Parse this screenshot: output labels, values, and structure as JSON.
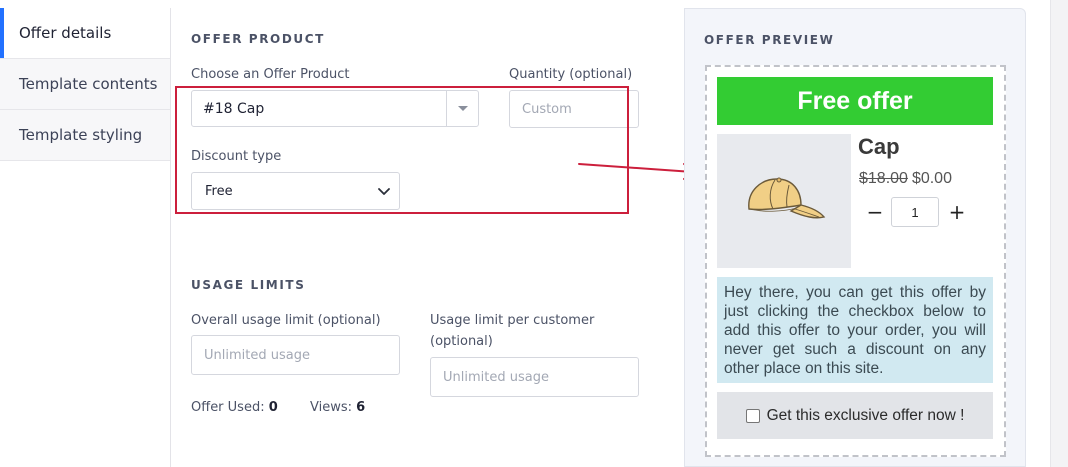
{
  "tabs": [
    {
      "label": "Offer details",
      "active": true
    },
    {
      "label": "Template contents",
      "active": false
    },
    {
      "label": "Template styling",
      "active": false
    }
  ],
  "offer_product": {
    "title": "OFFER PRODUCT",
    "choose_label": "Choose an Offer Product",
    "selected_product": "#18 Cap",
    "quantity_label": "Quantity (optional)",
    "quantity_placeholder": "Custom",
    "discount_label": "Discount type",
    "discount_value": "Free"
  },
  "usage_limits": {
    "title": "USAGE LIMITS",
    "overall_label": "Overall usage limit (optional)",
    "overall_placeholder": "Unlimited usage",
    "per_customer_label_line1": "Usage limit per customer",
    "per_customer_label_line2": "(optional)",
    "per_customer_placeholder": "Unlimited usage",
    "offer_used_label": "Offer Used:",
    "offer_used_value": "0",
    "views_label": "Views:",
    "views_value": "6"
  },
  "preview": {
    "title": "OFFER PREVIEW",
    "banner": "Free offer",
    "product_name": "Cap",
    "old_price": "$18.00",
    "new_price": "$0.00",
    "qty_minus": "−",
    "qty_value": "1",
    "qty_plus": "+",
    "description": "Hey there, you can get this offer by just clicking the checkbox below to add this offer to your order, you will never get such a discount on any other place on this site.",
    "checkbox_label": "Get this exclusive offer now !"
  },
  "colors": {
    "accent": "#2271ff",
    "banner_green": "#33cc33",
    "annotation_red": "#cc1f3c",
    "desc_bg": "#d1e9f1"
  },
  "icons": {
    "select_arrow": "triangle-down-icon",
    "discount_chevron": "chevron-down-icon",
    "product_image": "cap-image"
  }
}
